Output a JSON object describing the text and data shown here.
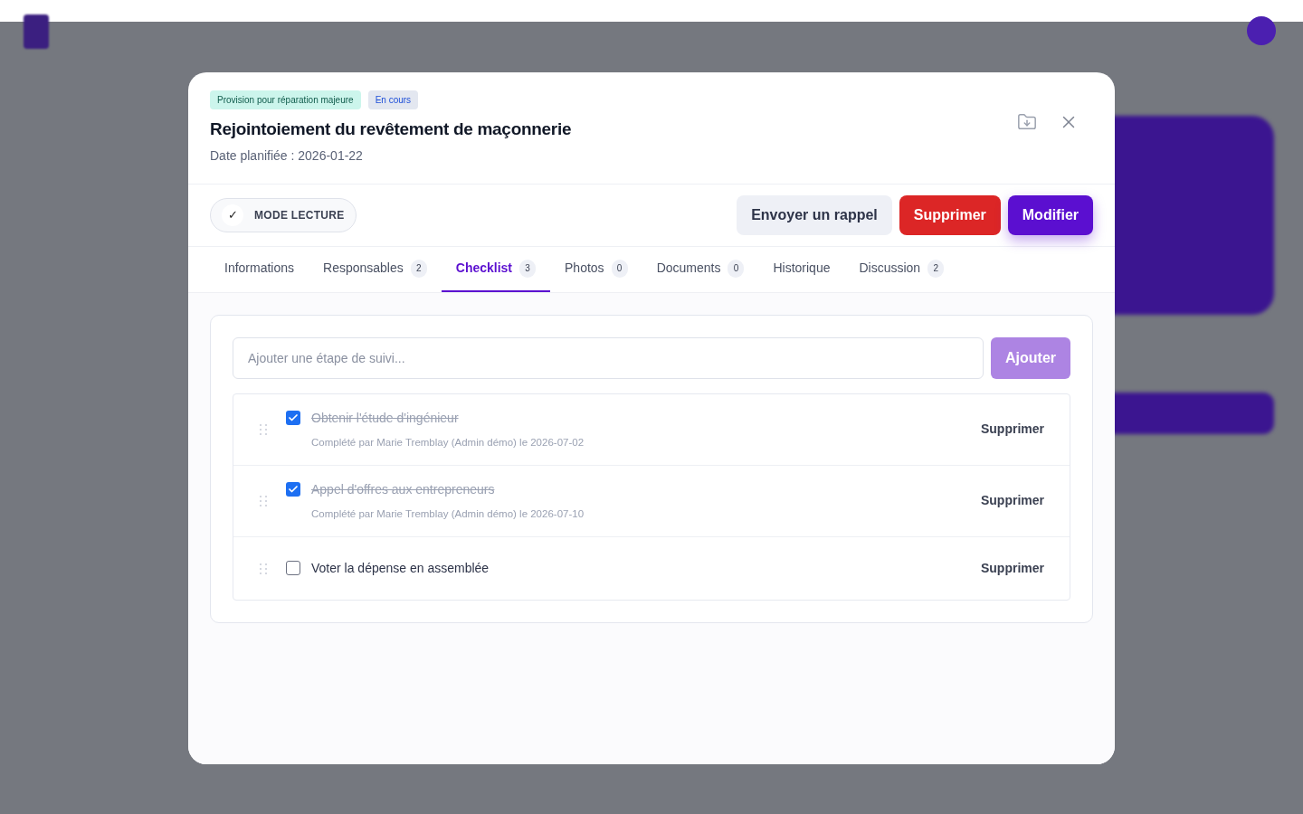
{
  "modal": {
    "tags": [
      {
        "label": "Provision pour réparation majeure",
        "kind": "category"
      },
      {
        "label": "En cours",
        "kind": "status"
      }
    ],
    "title": "Rejointoiement du revêtement de maçonnerie",
    "subtitle": "Date planifiée : 2026-01-22",
    "read_mode": {
      "icon": "✓",
      "label": "MODE LECTURE",
      "on": true
    },
    "buttons": [
      {
        "label": "Envoyer un rappel",
        "kind": "secondary"
      },
      {
        "label": "Supprimer",
        "kind": "danger"
      },
      {
        "label": "Modifier",
        "kind": "primary"
      }
    ],
    "tabs": [
      {
        "label": "Informations",
        "selected": false
      },
      {
        "label": "Responsables",
        "count": "2",
        "selected": false
      },
      {
        "label": "Checklist",
        "count": "3",
        "selected": true
      },
      {
        "label": "Photos",
        "count": "0",
        "selected": false
      },
      {
        "label": "Documents",
        "count": "0",
        "selected": false
      },
      {
        "label": "Historique",
        "selected": false
      },
      {
        "label": "Discussion",
        "count": "2",
        "selected": false
      }
    ],
    "checklist": {
      "input": {
        "placeholder": "Ajouter une étape de suivi..."
      },
      "add_button": "Ajouter",
      "items": [
        {
          "label": "Obtenir l'étude d'ingénieur",
          "checked": true,
          "note": "Complété par Marie Tremblay (Admin démo) le 2026-07-02",
          "action": "Supprimer"
        },
        {
          "label": "Appel d'offres aux entrepreneurs",
          "checked": true,
          "note": "Complété par Marie Tremblay (Admin démo) le 2026-07-10",
          "action": "Supprimer"
        },
        {
          "label": "Voter la dépense en assemblée",
          "checked": false,
          "action": "Supprimer"
        }
      ]
    }
  }
}
